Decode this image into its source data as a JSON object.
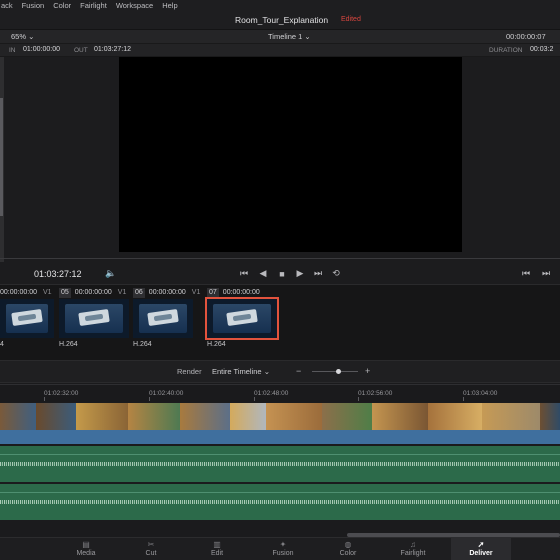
{
  "menu": [
    "ack",
    "Fusion",
    "Color",
    "Fairlight",
    "Workspace",
    "Help"
  ],
  "project": {
    "title": "Room_Tour_Explanation",
    "status": "Edited"
  },
  "viewer": {
    "zoom": "65%",
    "timeline": "Timeline 1",
    "timecode_right": "00:00:00:07",
    "in_label": "IN",
    "in_value": "01:00:00:00",
    "out_label": "OUT",
    "out_value": "01:03:27:12",
    "duration_label": "DURATION",
    "duration_value": "00:03:2"
  },
  "transport": {
    "timecode": "01:03:27:12"
  },
  "clips": [
    {
      "num": "",
      "tc": "00:00:00:00",
      "track": "V1",
      "codec": "4"
    },
    {
      "num": "05",
      "tc": "00:00:00:00",
      "track": "V1",
      "codec": "H.264"
    },
    {
      "num": "06",
      "tc": "00:00:00:00",
      "track": "V1",
      "codec": "H.264"
    },
    {
      "num": "07",
      "tc": "00:00:00:00",
      "track": "",
      "codec": "H.264"
    }
  ],
  "render": {
    "label": "Render",
    "range": "Entire Timeline"
  },
  "ruler": [
    "01:02:32:00",
    "01:02:40:00",
    "01:02:48:00",
    "01:02:56:00",
    "01:03:04:00"
  ],
  "pages": [
    {
      "label": "Media",
      "icon": "media-icon"
    },
    {
      "label": "Cut",
      "icon": "cut-icon"
    },
    {
      "label": "Edit",
      "icon": "edit-icon"
    },
    {
      "label": "Fusion",
      "icon": "fusion-icon"
    },
    {
      "label": "Color",
      "icon": "color-icon"
    },
    {
      "label": "Fairlight",
      "icon": "fairlight-icon"
    },
    {
      "label": "Deliver",
      "icon": "deliver-icon"
    }
  ],
  "colors": {
    "accent_red": "#d9463f",
    "video_track": "#3f6f9e",
    "audio_track": "#2c6a4a"
  }
}
